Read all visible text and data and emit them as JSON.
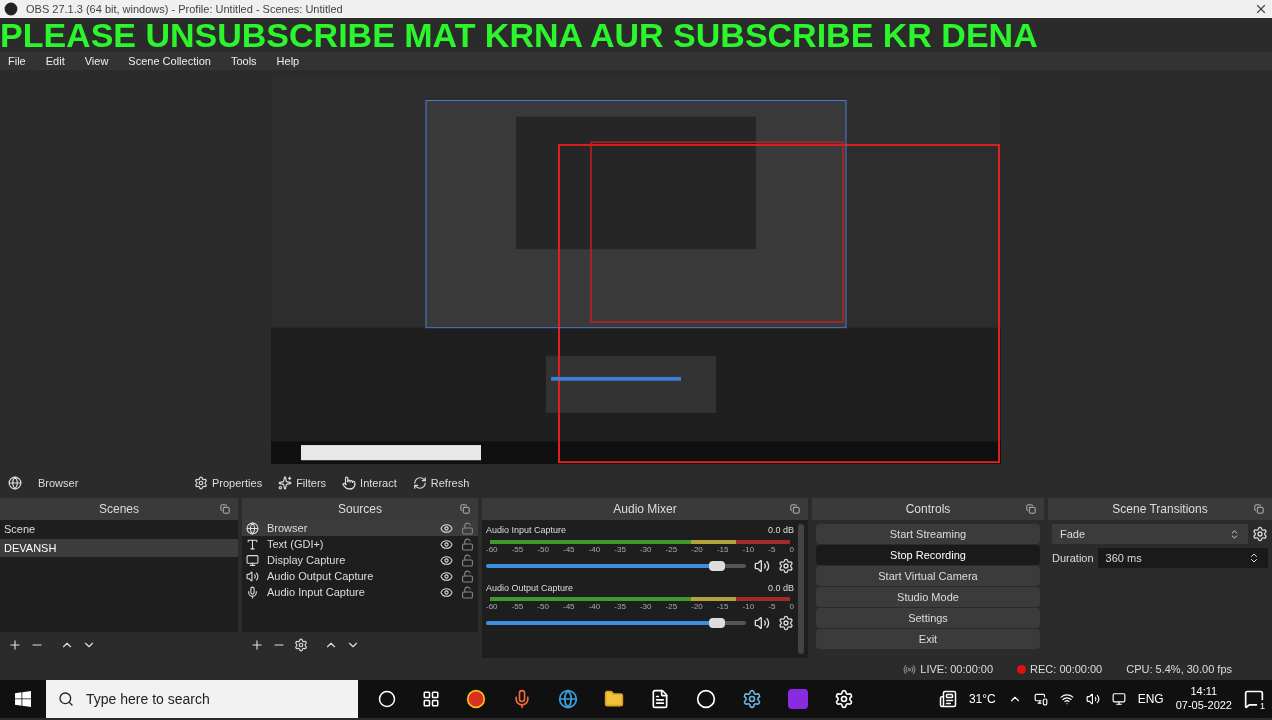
{
  "window": {
    "title": "OBS 27.1.3 (64 bit, windows) - Profile: Untitled - Scenes: Untitled"
  },
  "menu": [
    "File",
    "Edit",
    "View",
    "Scene Collection",
    "Tools",
    "Help"
  ],
  "overlay_text": "PLEASE UNSUBSCRIBE MAT KRNA  AUR SUBSCRIBE KR DENA",
  "source_toolbar": {
    "source": "Browser",
    "buttons": [
      {
        "label": "Properties",
        "kind": "properties"
      },
      {
        "label": "Filters",
        "kind": "filters"
      },
      {
        "label": "Interact",
        "kind": "interact"
      },
      {
        "label": "Refresh",
        "kind": "refresh"
      }
    ]
  },
  "scenes": {
    "title": "Scenes",
    "items": [
      {
        "name": "Scene",
        "selected": false
      },
      {
        "name": "DEVANSH",
        "selected": true
      }
    ]
  },
  "sources": {
    "title": "Sources",
    "items": [
      {
        "name": "Browser",
        "kind": "browser",
        "selected": true,
        "visible": true,
        "locked": false
      },
      {
        "name": "Text (GDI+)",
        "kind": "text",
        "selected": false,
        "visible": true,
        "locked": false
      },
      {
        "name": "Display Capture",
        "kind": "display",
        "selected": false,
        "visible": true,
        "locked": false
      },
      {
        "name": "Audio Output Capture",
        "kind": "speaker",
        "selected": false,
        "visible": true,
        "locked": false
      },
      {
        "name": "Audio Input Capture",
        "kind": "mic",
        "selected": false,
        "visible": true,
        "locked": false
      }
    ]
  },
  "audio_mixer": {
    "title": "Audio Mixer",
    "channels": [
      {
        "name": "Audio Input Capture",
        "reading": "0.0 dB",
        "level": 0.92,
        "ticks": [
          "-60",
          "-55",
          "-50",
          "-45",
          "-40",
          "-35",
          "-30",
          "-25",
          "-20",
          "-15",
          "-10",
          "-5",
          "0"
        ]
      },
      {
        "name": "Audio Output Capture",
        "reading": "0.0 dB",
        "level": 0.92,
        "ticks": [
          "-60",
          "-55",
          "-50",
          "-45",
          "-40",
          "-35",
          "-30",
          "-25",
          "-20",
          "-15",
          "-10",
          "-5",
          "0"
        ]
      }
    ]
  },
  "controls": {
    "title": "Controls",
    "buttons": [
      {
        "label": "Start Streaming",
        "active": false
      },
      {
        "label": "Stop Recording",
        "active": true
      },
      {
        "label": "Start Virtual Camera",
        "active": false
      },
      {
        "label": "Studio Mode",
        "active": false
      },
      {
        "label": "Settings",
        "active": false
      },
      {
        "label": "Exit",
        "active": false
      }
    ]
  },
  "transitions": {
    "title": "Scene Transitions",
    "transition": "Fade",
    "duration_label": "Duration",
    "duration": "360 ms"
  },
  "status_bar": {
    "live": "LIVE: 00:00:00",
    "rec": "REC: 00:00:00",
    "cpu": "CPU: 5.4%, 30.00 fps"
  },
  "taskbar": {
    "search_placeholder": "Type here to search",
    "weather": "31°C",
    "language": "ENG",
    "time": "14:11",
    "date": "07-05-2022",
    "notifications": "1"
  }
}
